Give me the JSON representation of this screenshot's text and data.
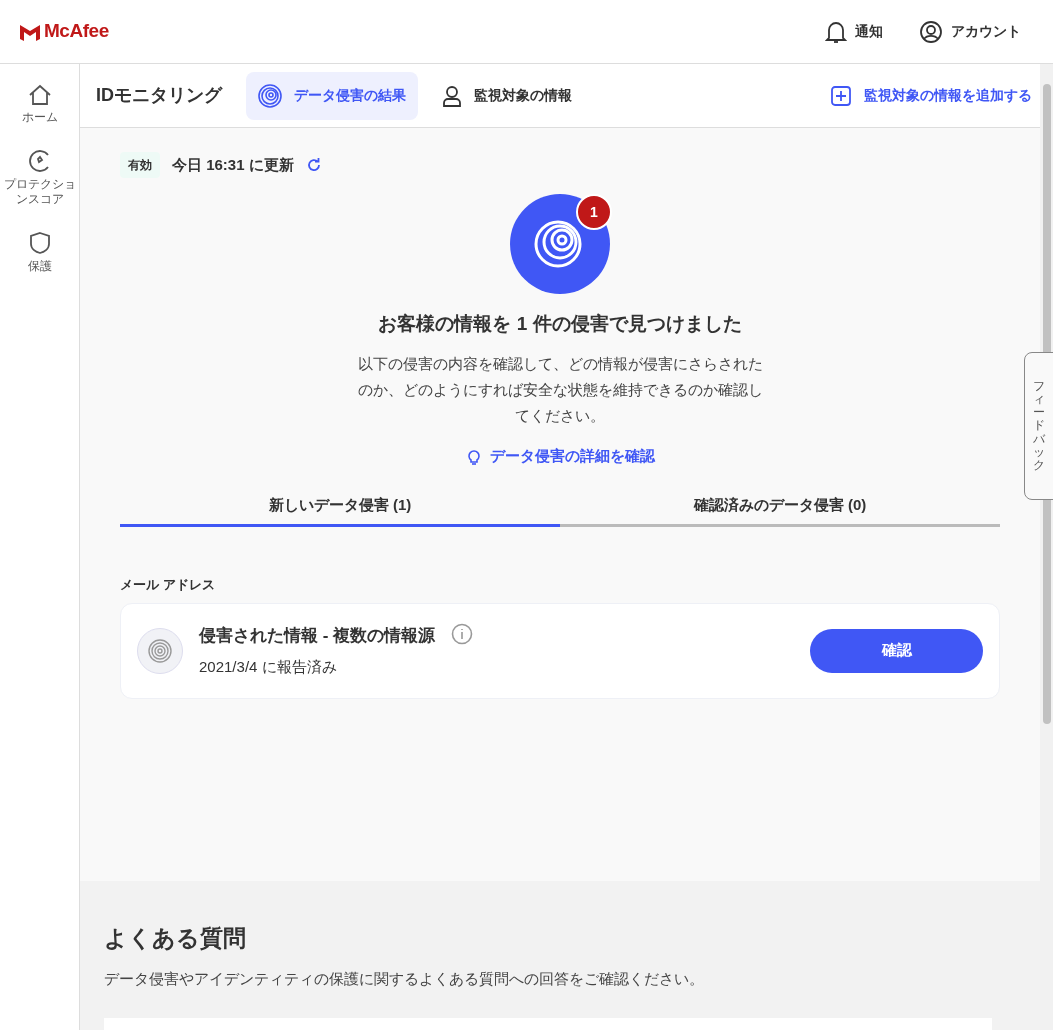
{
  "header": {
    "logo": "McAfee",
    "actions": [
      {
        "kind": "bell",
        "label": "通知"
      },
      {
        "kind": "account",
        "label": "アカウント"
      }
    ]
  },
  "sidebar": {
    "items": [
      {
        "kind": "home",
        "label": "ホーム"
      },
      {
        "kind": "score",
        "label": "プロテクションスコア"
      },
      {
        "kind": "shield",
        "label": "保護"
      }
    ]
  },
  "subheader": {
    "title": "IDモニタリング",
    "tabs": [
      {
        "kind": "fingerprint",
        "label": "データ侵害の結果",
        "selected": true
      },
      {
        "kind": "person",
        "label": "監視対象の情報",
        "selected": false
      }
    ],
    "add_link": "監視対象の情報を追加する"
  },
  "status": {
    "badge": "有効",
    "updated": "今日 16:31 に更新"
  },
  "summary": {
    "count_badge": "1",
    "heading": "お客様の情報を 1 件の侵害で見つけました",
    "description": "以下の侵害の内容を確認して、どの情報が侵害にさらされたのか、どのようにすれば安全な状態を維持できるのか確認してください。",
    "details_link": "データ侵害の詳細を確認"
  },
  "breach_tabs": [
    {
      "label": "新しいデータ侵害 (1)",
      "selected": true
    },
    {
      "label": "確認済みのデータ侵害 (0)",
      "selected": false
    }
  ],
  "section_label": "メール アドレス",
  "breaches": [
    {
      "title": "侵害された情報 - 複数の情報源",
      "date": "2021/3/4 に報告済み",
      "button": "確認"
    }
  ],
  "feedback": "フィードバック",
  "faq": {
    "title": "よくある質問",
    "description": "データ侵害やアイデンティティの保護に関するよくある質問への回答をご確認ください。"
  }
}
